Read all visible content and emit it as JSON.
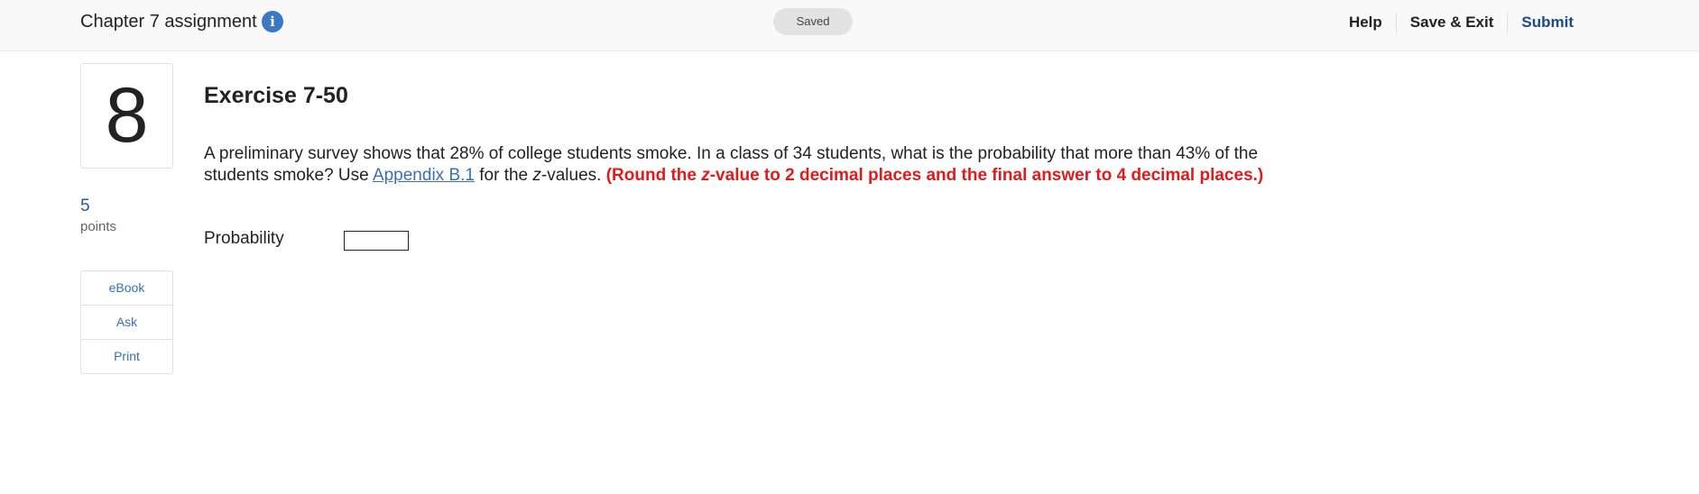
{
  "header": {
    "assignment_title": "Chapter 7 assignment",
    "info_icon": "i",
    "saved_status": "Saved",
    "nav": {
      "help": "Help",
      "save_exit": "Save & Exit",
      "submit": "Submit"
    }
  },
  "question": {
    "number": "8",
    "points_value": "5",
    "points_label": "points",
    "tools": [
      "eBook",
      "Ask",
      "Print"
    ],
    "title": "Exercise 7-50",
    "text_part1": "A preliminary survey shows that 28% of college students smoke. In a class of 34 students, what is the probability that more than 43% of the students smoke? Use ",
    "link_text": "Appendix B.1",
    "text_part2": " for the ",
    "z_italic": "z",
    "text_part3": "-values. ",
    "instruction_part1": "(Round the ",
    "instruction_z": "z",
    "instruction_part2": "-value to 2 decimal places and the final answer to 4 decimal places.)",
    "answer_label": "Probability",
    "answer_value": "",
    "answer_placeholder": ""
  },
  "colors": {
    "link_blue": "#3a70b3",
    "instruction_red": "#e01b1b",
    "info_icon_bg": "#3b78c3"
  }
}
